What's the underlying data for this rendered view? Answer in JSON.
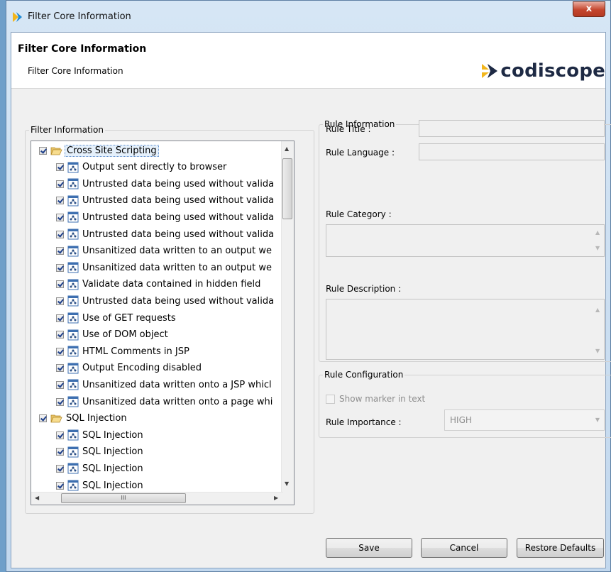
{
  "window": {
    "title": "Filter Core Information",
    "close_glyph": "x"
  },
  "header": {
    "title": "Filter Core Information",
    "subtitle": "Filter Core Information",
    "logo_text": "codiscope"
  },
  "filter_panel": {
    "legend": "Filter Information",
    "tree": [
      {
        "type": "category",
        "label": "Cross Site Scripting",
        "checked": true,
        "selected": true
      },
      {
        "type": "rule",
        "label": "Output sent directly to browser",
        "checked": true
      },
      {
        "type": "rule",
        "label": "Untrusted data being used without valida",
        "checked": true
      },
      {
        "type": "rule",
        "label": "Untrusted data being used without valida",
        "checked": true
      },
      {
        "type": "rule",
        "label": "Untrusted data being used without valida",
        "checked": true
      },
      {
        "type": "rule",
        "label": "Untrusted data being used without valida",
        "checked": true
      },
      {
        "type": "rule",
        "label": "Unsanitized data written to an output we",
        "checked": true
      },
      {
        "type": "rule",
        "label": "Unsanitized data written to an output we",
        "checked": true
      },
      {
        "type": "rule",
        "label": "Validate data contained in hidden field",
        "checked": true
      },
      {
        "type": "rule",
        "label": "Untrusted data being used without valida",
        "checked": true
      },
      {
        "type": "rule",
        "label": "Use of GET requests",
        "checked": true
      },
      {
        "type": "rule",
        "label": "Use of DOM object",
        "checked": true
      },
      {
        "type": "rule",
        "label": "HTML Comments in JSP",
        "checked": true
      },
      {
        "type": "rule",
        "label": "Output Encoding disabled",
        "checked": true
      },
      {
        "type": "rule",
        "label": "Unsanitized data written onto a JSP whicl",
        "checked": true
      },
      {
        "type": "rule",
        "label": "Unsanitized data written onto a page whi",
        "checked": true
      },
      {
        "type": "category",
        "label": "SQL Injection",
        "checked": true,
        "selected": false
      },
      {
        "type": "rule",
        "label": "SQL Injection",
        "checked": true
      },
      {
        "type": "rule",
        "label": "SQL Injection",
        "checked": true
      },
      {
        "type": "rule",
        "label": "SQL Injection",
        "checked": true
      },
      {
        "type": "rule",
        "label": "SQL Injection",
        "checked": true
      }
    ],
    "hscroll_grip": "III"
  },
  "rule_info": {
    "legend": "Rule Information",
    "title_label": "Rule Title :",
    "title_value": "",
    "language_label": "Rule Language :",
    "language_value": "",
    "category_label": "Rule Category :",
    "category_value": "",
    "description_label": "Rule Description :",
    "description_value": ""
  },
  "rule_config": {
    "legend": "Rule Configuration",
    "show_marker_label": "Show marker in text",
    "show_marker_checked": false,
    "importance_label": "Rule Importance :",
    "importance_value": "HIGH"
  },
  "buttons": {
    "save": "Save",
    "cancel": "Cancel",
    "restore": "Restore Defaults"
  },
  "colors": {
    "accent": "#3d6fb0",
    "logo_dark": "#1e2a44",
    "logo_yellow": "#f2b61c"
  }
}
